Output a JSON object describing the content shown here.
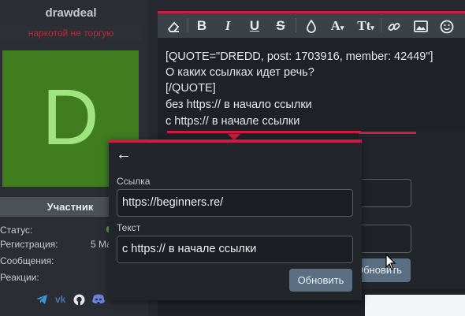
{
  "user": {
    "name": "drawdeal",
    "title": "наркотой не торгую",
    "avatar_letter": "D",
    "role": "Участник",
    "stats": {
      "status_label": "Статус:",
      "registration_label": "Регистрация:",
      "registration_value": "5 Ма",
      "messages_label": "Сообщения:",
      "reactions_label": "Реакции:"
    },
    "social": [
      "telegram-icon",
      "vk-icon",
      "github-icon",
      "discord-icon"
    ]
  },
  "toolbar": {
    "eraser": "⌫",
    "bold": "B",
    "italic": "I",
    "underline": "U",
    "strike": "S",
    "color": "💧",
    "font": "A",
    "size": "Tt",
    "link": "🔗",
    "image": "▣",
    "smile": "☺"
  },
  "editor": {
    "lines": [
      "[QUOTE=\"DREDD, post: 1703916, member: 42449\"]",
      "О каких ссылках идет речь?",
      "[/QUOTE]",
      "без https:// в начало ссылки",
      "с https:// в начале ссылки"
    ]
  },
  "bg_popup": {
    "update_label": "Обновить"
  },
  "link_dialog": {
    "back_symbol": "←",
    "url_label": "Ссылка",
    "url_value": "https://beginners.re/",
    "text_label": "Текст",
    "text_value": "с https:// в начале ссылки",
    "update_label": "Обновить"
  },
  "colors": {
    "accent": "#c81d44",
    "avatar_bg": "#3f7d1f",
    "avatar_letter": "#9fe47f",
    "button": "#5a6f82"
  }
}
